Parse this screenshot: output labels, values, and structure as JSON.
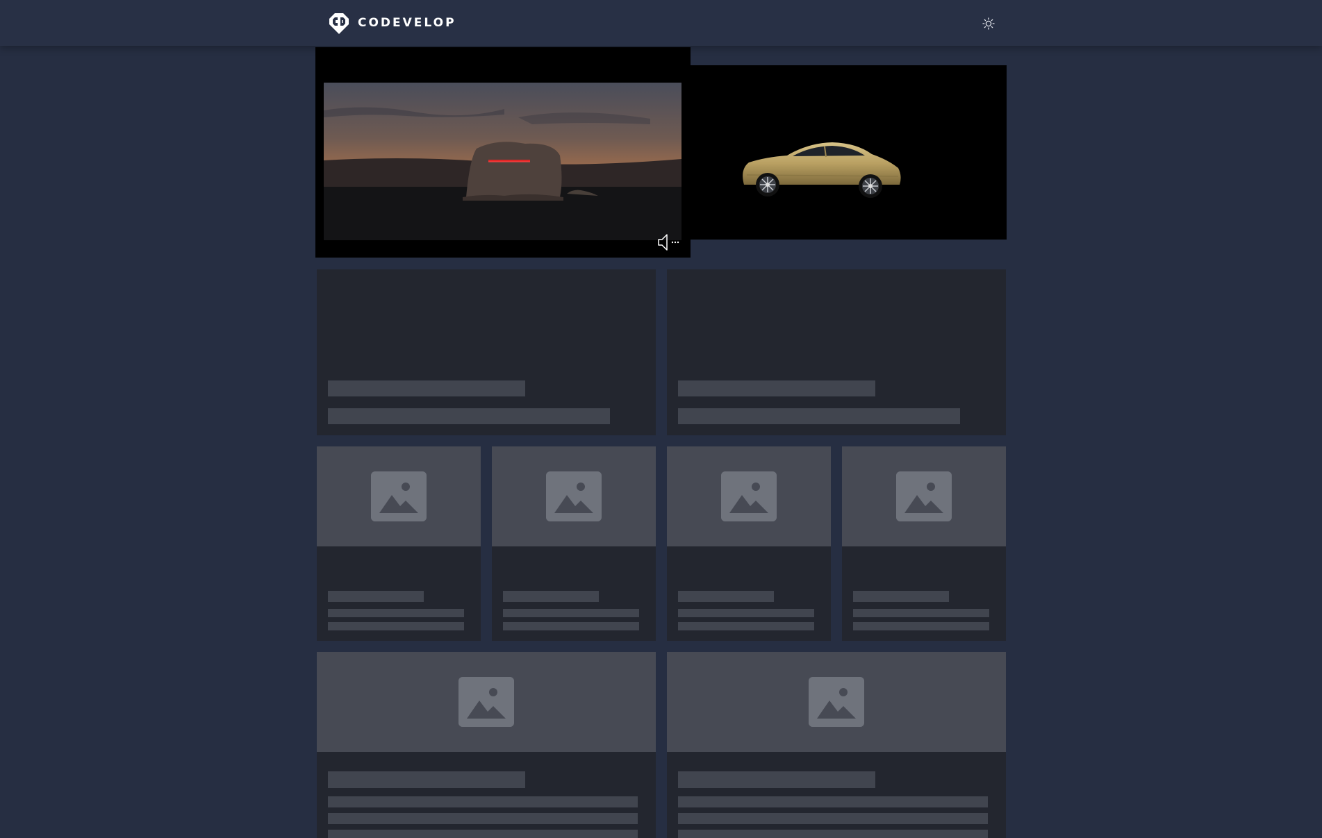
{
  "header": {
    "brand": "CODEVELOP",
    "logo_icon": "codevelop-logo-icon",
    "theme_icon": "sun-icon"
  },
  "hero": {
    "mute_icon": "speaker-muted-icon"
  },
  "colors": {
    "page_background": "#262e42",
    "header_background": "#283045",
    "card_background": "#23262f",
    "skeleton": "#41454f",
    "image_placeholder": "#474a54",
    "placeholder_icon": "#6f737c",
    "car_paint": "#b9a062"
  },
  "placeholders": {
    "icon": "image-placeholder-icon"
  }
}
